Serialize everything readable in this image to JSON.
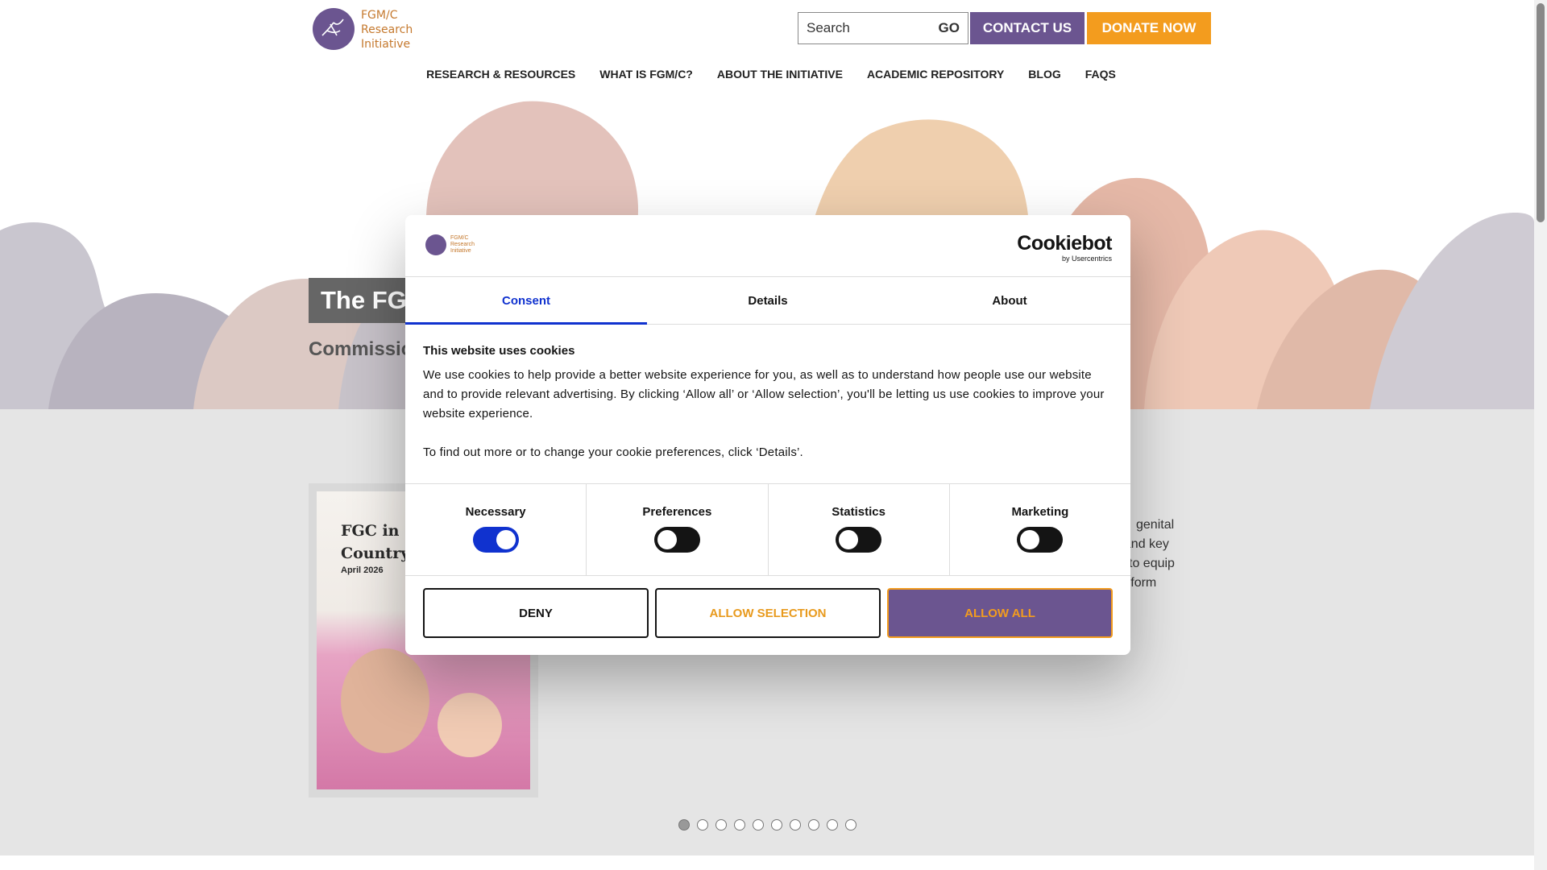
{
  "header": {
    "logo_lines": [
      "FGM/C",
      "Research",
      "Initiative"
    ],
    "search_placeholder": "Search",
    "go_label": "GO",
    "contact_label": "CONTACT US",
    "donate_label": "DONATE NOW"
  },
  "nav": {
    "items": [
      "RESEARCH & RESOURCES",
      "WHAT IS FGM/C?",
      "ABOUT THE INITIATIVE",
      "ACADEMIC REPOSITORY",
      "BLOG",
      "FAQS"
    ]
  },
  "hero": {
    "title": "The FGM/C Research Initiative",
    "subtitle": "Commissio"
  },
  "card": {
    "title_line1": "FGC in In",
    "title_line2": "Country I",
    "date": "April 2026"
  },
  "side_text": {
    "lines": [
      "genital",
      "ks, and key",
      "is to equip",
      "to inform"
    ]
  },
  "carousel": {
    "dot_count": 10,
    "active_index": 0
  },
  "cookie_dialog": {
    "logo_lines": [
      "FGM/C",
      "Research",
      "Initiative"
    ],
    "brand": "Cookiebot",
    "brand_sub": "by Usercentrics",
    "tabs": [
      "Consent",
      "Details",
      "About"
    ],
    "active_tab": "Consent",
    "heading": "This website uses cookies",
    "paragraph1": "We use cookies to help provide a better website experience for you, as well as to understand how people use our website and to provide relevant advertising. By clicking ‘Allow all’ or ‘Allow selection’, you'll be letting us use cookies to improve your website experience.",
    "paragraph2": "To find out more or to change your cookie preferences, click ‘Details’.",
    "toggles": [
      {
        "label": "Necessary",
        "on": true
      },
      {
        "label": "Preferences",
        "on": false
      },
      {
        "label": "Statistics",
        "on": false
      },
      {
        "label": "Marketing",
        "on": false
      }
    ],
    "buttons": {
      "deny": "DENY",
      "allow_selection": "ALLOW SELECTION",
      "allow_all": "ALLOW ALL"
    }
  },
  "colors": {
    "brand_purple": "#6b5590",
    "brand_orange": "#f39c1e",
    "cookiebot_blue": "#1032cf"
  }
}
